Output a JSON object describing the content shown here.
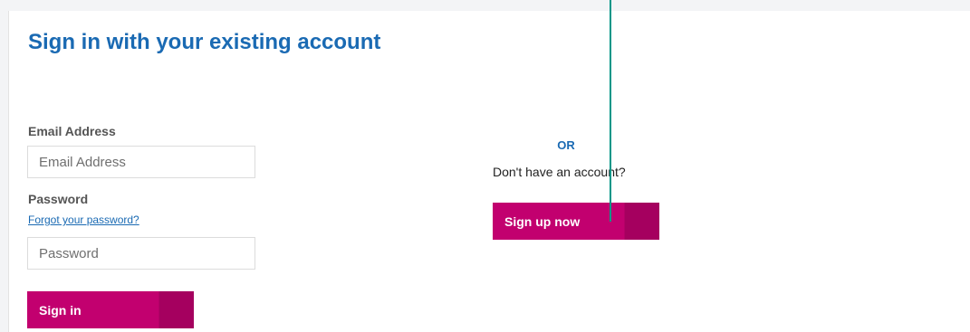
{
  "title": "Sign in with your existing account",
  "email": {
    "label": "Email Address",
    "placeholder": "Email Address",
    "value": ""
  },
  "password": {
    "label": "Password",
    "forgot_link": "Forgot your password?",
    "placeholder": "Password",
    "value": ""
  },
  "signin_label": "Sign in",
  "signup": {
    "or_label": "OR",
    "prompt": "Don't have an account?",
    "button_label": "Sign up now"
  },
  "colors": {
    "brand_primary": "#c2006f",
    "brand_dark": "#a5005f",
    "title_blue": "#1a6ab3",
    "cursor_teal": "#009688"
  }
}
